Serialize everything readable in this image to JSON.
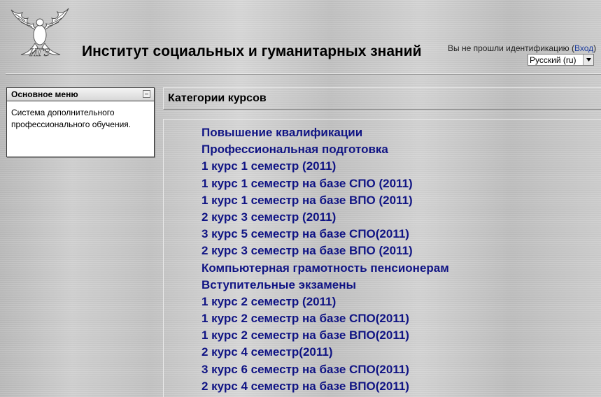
{
  "header": {
    "logo_icon": "phoenix-emblem-logo",
    "site_title": "Институт социальных и гуманитарных знаний",
    "login_text": "Вы не прошли идентификацию (",
    "login_link": "Вход",
    "login_suffix": ")",
    "language": "Русский (ru)",
    "language_arrow_icon": "dropdown-arrow-icon"
  },
  "sidebar": {
    "block_title": "Основное меню",
    "collapse_icon": "collapse-icon",
    "block_text": "Система дополнительного профессионального обучения."
  },
  "main": {
    "section_title": "Категории курсов",
    "categories": [
      "Повышение квалификации",
      "Профессиональная подготовка",
      "1 курс 1 семестр (2011)",
      "1 курс 1 семестр на базе СПО (2011)",
      "1 курс 1 семестр на базе ВПО (2011)",
      "2 курс 3 семестр (2011)",
      "3 курс 5 семестр на базе СПО(2011)",
      "2 курс 3 семестр на базе ВПО (2011)",
      "Компьютерная грамотность пенсионерам",
      "Вступительные экзамены",
      "1 курс 2 семестр (2011)",
      "1 курс 2 семестр на базе СПО(2011)",
      "1 курс 2 семестр на базе ВПО(2011)",
      "2 курс 4 семестр(2011)",
      "3 курс 6 семестр на базе СПО(2011)",
      "2 курс 4 семестр на базе ВПО(2011)"
    ]
  },
  "colors": {
    "link": "#101484",
    "login_link": "#1a3a9c",
    "background": "#c8c8c8"
  }
}
